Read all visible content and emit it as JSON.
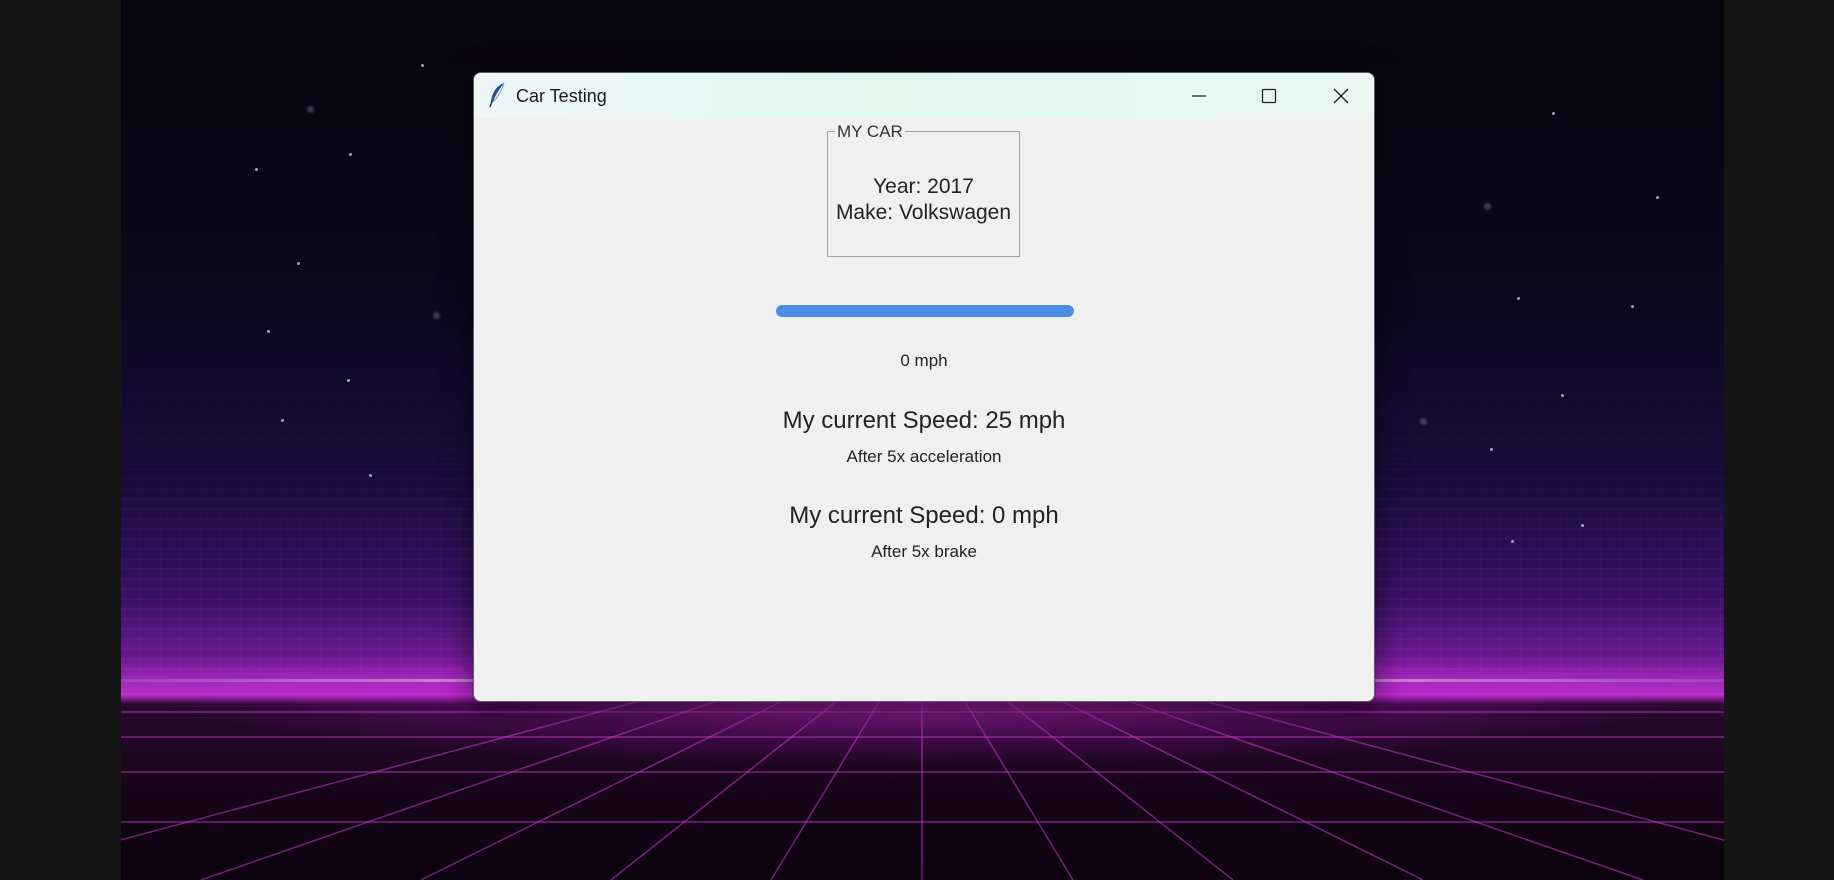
{
  "window": {
    "title": "Car Testing",
    "app_icon": "feather-icon",
    "controls": {
      "minimize_icon": "minimize-icon",
      "maximize_icon": "maximize-icon",
      "close_icon": "close-icon"
    }
  },
  "car_frame": {
    "caption": "MY CAR",
    "year_line": "Year: 2017",
    "make_line": "Make: Volkswagen"
  },
  "speed_meter": {
    "progress_fraction": 1.0,
    "fill_color": "#4c8ee3",
    "label": "0 mph"
  },
  "results": {
    "acceleration": {
      "speed_text": "My current Speed:  25 mph",
      "caption": "After 5x acceleration"
    },
    "brake": {
      "speed_text": "My current Speed:  0 mph",
      "caption": "After 5x brake"
    }
  }
}
